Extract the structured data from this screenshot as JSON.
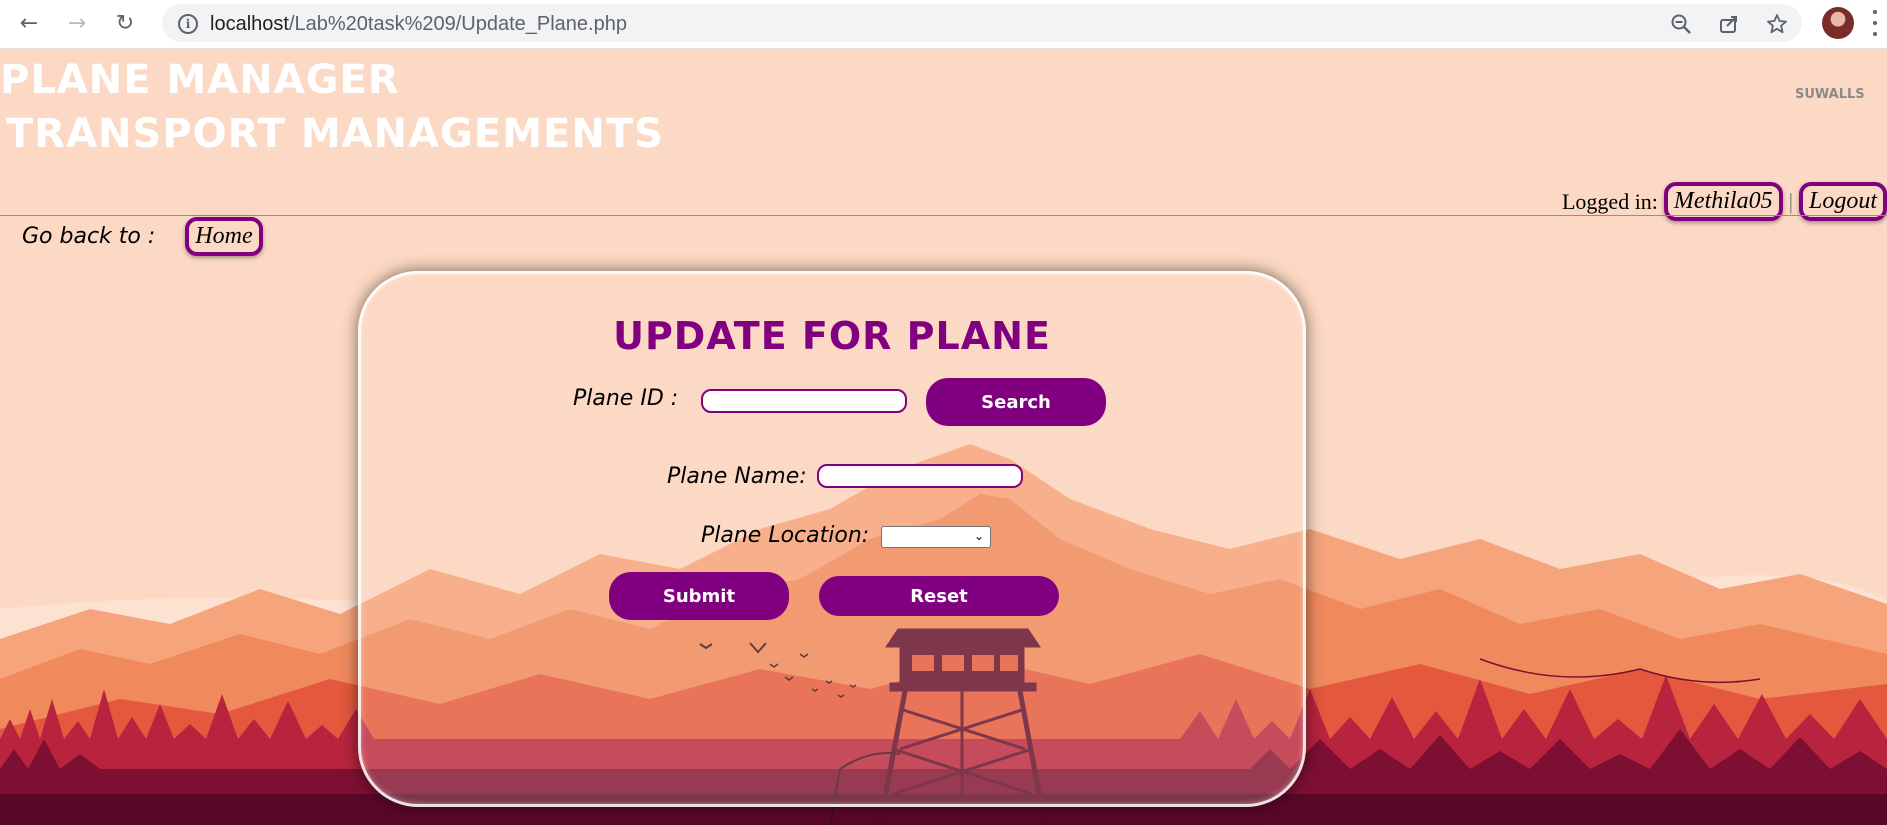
{
  "browser": {
    "url_host": "localhost",
    "url_path": "/Lab%20task%209/Update_Plane.php",
    "back_icon": "arrow-left-icon",
    "forward_icon": "arrow-right-icon",
    "reload_icon": "reload-icon",
    "info_icon": "info-icon",
    "zoom_icon": "zoom-out-icon",
    "share_icon": "share-icon",
    "bookmark_icon": "star-icon",
    "menu_icon": "kebab-menu-icon"
  },
  "header": {
    "title_line1": "PLANE MANAGER",
    "title_line2": "TRANSPORT MANAGEMENTS",
    "brand_mark": "SUWALLS"
  },
  "login": {
    "label": "Logged in:",
    "username": "Methila05",
    "separator": "|",
    "logout": "Logout"
  },
  "nav": {
    "goback_label": "Go back to :",
    "home_link": "Home"
  },
  "form": {
    "title": "UPDATE FOR PLANE",
    "plane_id_label": "Plane ID :",
    "plane_id_value": "",
    "search_button": "Search",
    "plane_name_label": "Plane Name:",
    "plane_name_value": "",
    "plane_location_label": "Plane Location:",
    "plane_location_value": "",
    "submit_button": "Submit",
    "reset_button": "Reset"
  },
  "colors": {
    "accent": "#800080",
    "background": "#fcd9c4",
    "mountain_far": "#f6a47c",
    "mountain_peak": "#f08a5d",
    "hills_mid": "#e4583d",
    "forest_dark": "#7d0f32",
    "forest_deep": "#5a0828"
  }
}
